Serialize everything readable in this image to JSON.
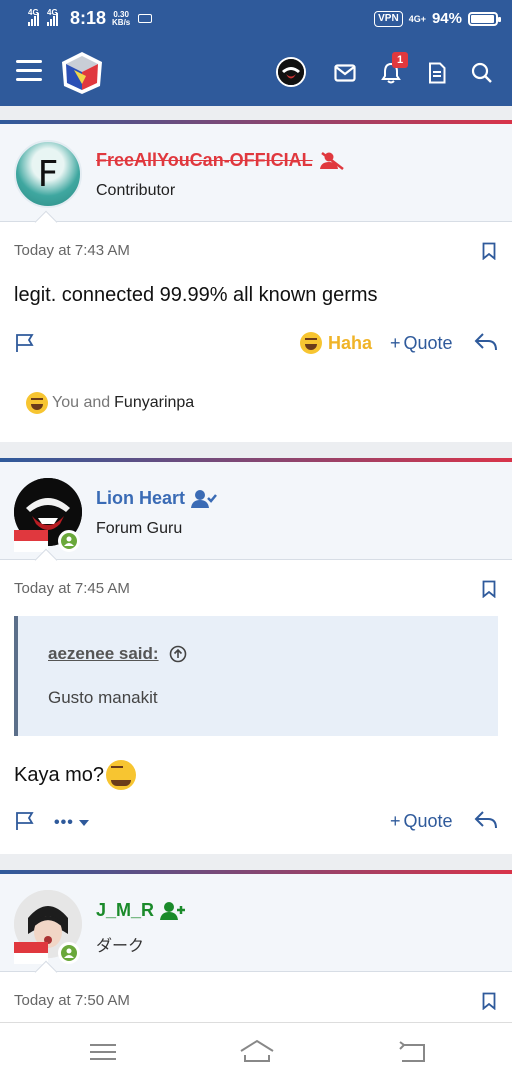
{
  "status_bar": {
    "network1": "4G",
    "network2": "4G",
    "time": "8:18",
    "speed_value": "0.30",
    "speed_unit": "KB/s",
    "vpn": "VPN",
    "network3": "4G+",
    "battery_text": "94%",
    "battery_level": 0.94
  },
  "header": {
    "notification_count": "1"
  },
  "posts": [
    {
      "username": "FreeAllYouCan-OFFICIAL",
      "user_title": "Contributor",
      "avatar_letter": "F",
      "time": "Today at 7:43 AM",
      "message": "legit. connected 99.99% all known germs",
      "reaction_label": "Haha",
      "quote_label": "Quote",
      "reactions_you": "You and",
      "reactions_name": "Funyarinpa"
    },
    {
      "username": "Lion Heart",
      "user_title": "Forum Guru",
      "time": "Today at 7:45 AM",
      "quote_author": "aezenee said:",
      "quote_text": "Gusto manakit",
      "message": "Kaya mo?",
      "more_label": "•••",
      "quote_label": "Quote"
    },
    {
      "username": "J_M_R",
      "user_title": "ダーク",
      "time": "Today at 7:50 AM"
    }
  ],
  "colors": {
    "primary": "#2f5a9b",
    "accent_red": "#d8344a",
    "username_blue": "#3a6bb5",
    "username_red": "#e0383e",
    "username_green": "#1a8a2a",
    "haha_gold": "#f0b429"
  }
}
